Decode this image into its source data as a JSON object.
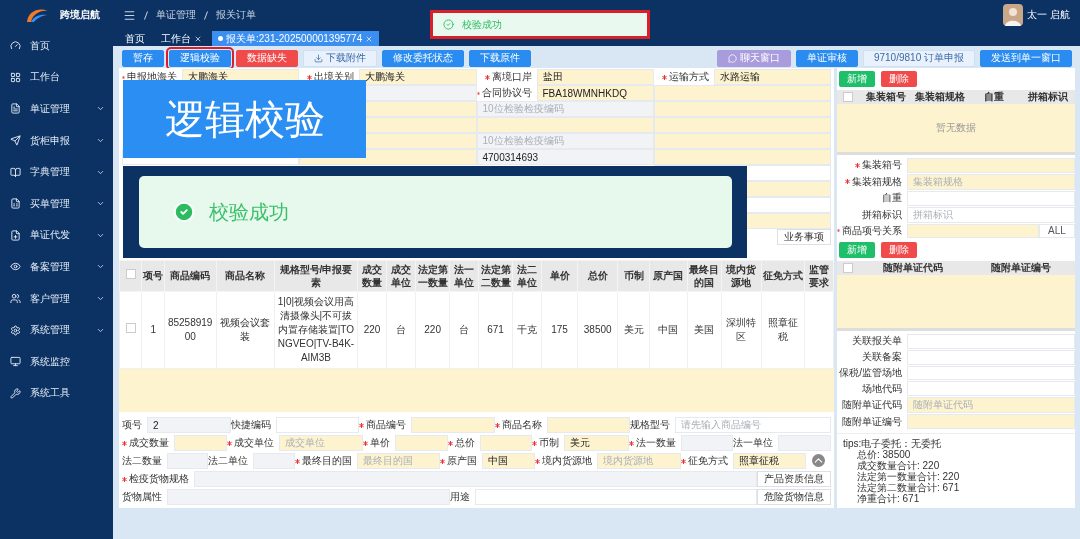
{
  "sidebar": {
    "brand": "跨境启航",
    "items": [
      {
        "label": "首页",
        "expandable": false
      },
      {
        "label": "工作台",
        "expandable": false
      },
      {
        "label": "单证管理",
        "expandable": true
      },
      {
        "label": "货柜申报",
        "expandable": true
      },
      {
        "label": "字典管理",
        "expandable": true
      },
      {
        "label": "买单管理",
        "expandable": true
      },
      {
        "label": "单证代发",
        "expandable": true
      },
      {
        "label": "备案管理",
        "expandable": true
      },
      {
        "label": "客户管理",
        "expandable": true
      },
      {
        "label": "系统管理",
        "expandable": true
      },
      {
        "label": "系统监控",
        "expandable": false
      },
      {
        "label": "系统工具",
        "expandable": false
      }
    ]
  },
  "header": {
    "breadcrumb": [
      "单证管理",
      "报关订单"
    ],
    "user": "太一 启航"
  },
  "toast": {
    "text": "校验成功"
  },
  "tabs": [
    {
      "label": "首页",
      "selected": false,
      "closable": false
    },
    {
      "label": "工作台",
      "selected": false,
      "closable": true
    },
    {
      "label": "报关单:231-202500001395774",
      "selected": true,
      "closable": true
    }
  ],
  "toolbar": {
    "left": [
      {
        "label": "暂存",
        "kind": "primary",
        "highlighted": false
      },
      {
        "label": "逻辑校验",
        "kind": "primary",
        "highlighted": true
      },
      {
        "label": "数据缺失",
        "kind": "danger",
        "highlighted": false
      },
      {
        "label": "下载附件",
        "kind": "plain",
        "highlighted": false
      },
      {
        "label": "修改委托状态",
        "kind": "primary",
        "highlighted": false
      },
      {
        "label": "下载原件",
        "kind": "primary",
        "highlighted": false
      }
    ],
    "right": [
      {
        "label": "聊天窗口",
        "kind": "chat",
        "highlighted": false
      },
      {
        "label": "单证审核",
        "kind": "primary",
        "highlighted": false
      },
      {
        "label": "9710/9810 订单申报",
        "kind": "plain",
        "highlighted": false
      },
      {
        "label": "发送到单一窗口",
        "kind": "primary",
        "highlighted": false
      }
    ]
  },
  "form": {
    "rows": [
      [
        {
          "label": "申报地海关",
          "required": true,
          "value": "大鹏海关",
          "kind": "required"
        },
        {
          "label": "出境关别",
          "required": true,
          "value": "大鹏海关",
          "kind": "required"
        },
        {
          "label": "离境口岸",
          "required": true,
          "value": "盐田",
          "kind": "required"
        },
        {
          "label": "运输方式",
          "required": true,
          "value": "水路运输",
          "kind": "required"
        }
      ],
      [
        null,
        {
          "kind": "readonly"
        },
        {
          "label": "合同协议号",
          "required": true,
          "value": "FBA18WMNHKDQ",
          "kind": "required"
        },
        {
          "kind": "required"
        }
      ],
      [
        null,
        {
          "kind": "required"
        },
        {
          "kind": "readonly",
          "placeholder": "10位检验检疫编码"
        },
        {
          "kind": "required"
        }
      ],
      [
        null,
        {
          "kind": "required"
        },
        {
          "kind": "required"
        },
        {
          "kind": "required"
        }
      ],
      [
        null,
        {
          "kind": "required"
        },
        {
          "kind": "readonly",
          "placeholder": "10位检验检疫编码"
        },
        {
          "kind": "required"
        }
      ],
      [
        {
          "kind": "plain"
        },
        {
          "kind": "required"
        },
        {
          "kind": "readonly",
          "value": "4700314693"
        },
        {
          "kind": "required"
        }
      ],
      [
        null,
        null,
        null,
        {
          "kind": "plain"
        }
      ],
      [
        null,
        null,
        null,
        {
          "kind": "required"
        }
      ],
      [
        null,
        null,
        null,
        {
          "kind": "plain"
        }
      ],
      [
        null,
        null,
        null,
        {
          "kind": "required"
        }
      ],
      [
        null,
        null,
        null,
        {
          "kind": "action",
          "value": "业务事项"
        }
      ]
    ]
  },
  "callouts": {
    "title": "逻辑校验",
    "message": "校验成功"
  },
  "goods_table": {
    "all_checked": false,
    "columns": [
      "项号",
      "商品编码",
      "商品名称",
      "规格型号/申报要素",
      "成交数量",
      "成交单位",
      "法定第一数量",
      "法一单位",
      "法定第二数量",
      "法二单位",
      "单价",
      "总价",
      "币制",
      "原产国",
      "最终目的国",
      "境内货源地",
      "征免方式",
      "监管要求"
    ],
    "rows": [
      {
        "checked": false,
        "cells": [
          "1",
          "8525891900",
          "视频会议套装",
          "1|0|视频会议用高清摄像头|不可拔内置存储装置|TONGVEO|TV-B4K-AIM3B",
          "220",
          "台",
          "220",
          "台",
          "671",
          "千克",
          "175",
          "38500",
          "美元",
          "中国",
          "美国",
          "深圳特区",
          "照章征税"
        ]
      }
    ]
  },
  "item_form": {
    "lines": [
      {
        "fields": [
          {
            "label": "项号",
            "value": "2",
            "kind": "readonly"
          },
          {
            "label": "快捷编码",
            "kind": "plain"
          },
          {
            "label": "商品编号",
            "required": true,
            "kind": "required"
          },
          {
            "label": "商品名称",
            "required": true,
            "kind": "required"
          },
          {
            "label": "规格型号",
            "placeholder": "请先输入商品编号",
            "kind": "plain"
          }
        ]
      },
      {
        "fields": [
          {
            "label": "成交数量",
            "required": true,
            "kind": "required"
          },
          {
            "label": "成交单位",
            "required": true,
            "placeholder": "成交单位",
            "kind": "required"
          },
          {
            "label": "单价",
            "required": true,
            "kind": "required"
          },
          {
            "label": "总价",
            "required": true,
            "kind": "required"
          },
          {
            "label": "币制",
            "required": true,
            "value": "美元",
            "kind": "required"
          },
          {
            "label": "法一数量",
            "required": true,
            "kind": "readonly"
          },
          {
            "label": "法一单位",
            "kind": "readonly"
          }
        ]
      },
      {
        "fields": [
          {
            "label": "法二数量",
            "kind": "readonly"
          },
          {
            "label": "法二单位",
            "kind": "readonly"
          },
          {
            "label": "最终目的国",
            "required": true,
            "placeholder": "最终目的国",
            "kind": "required"
          },
          {
            "label": "原产国",
            "required": true,
            "value": "中国",
            "kind": "required"
          },
          {
            "label": "境内货源地",
            "required": true,
            "placeholder": "境内货源地",
            "kind": "required"
          },
          {
            "label": "征免方式",
            "required": true,
            "value": "照章征税",
            "kind": "required"
          }
        ]
      },
      {
        "fields": [
          {
            "label": "检疫货物规格",
            "required": true,
            "kind": "readonly"
          },
          {
            "label": "产品资质信息",
            "kind": "action"
          }
        ]
      },
      {
        "fields": [
          {
            "label": "货物属性",
            "kind": "readonly"
          },
          {
            "label": "用途",
            "kind": "plain"
          },
          {
            "label": "危险货物信息",
            "kind": "action"
          }
        ]
      }
    ]
  },
  "containers": {
    "add": "新增",
    "delete": "删除",
    "all_checked": false,
    "columns": [
      "集装箱号",
      "集装箱规格",
      "自重",
      "拼箱标识"
    ],
    "empty": "暂无数据",
    "fields": [
      {
        "label": "集装箱号",
        "required": true,
        "kind": "required"
      },
      {
        "label": "集装箱规格",
        "required": true,
        "placeholder": "集装箱规格",
        "kind": "required"
      },
      {
        "label": "自重",
        "kind": "plain"
      },
      {
        "label": "拼箱标识",
        "placeholder": "拼箱标识",
        "kind": "plain"
      },
      {
        "label": "商品项号关系",
        "required": true,
        "kind": "required",
        "addon": "ALL"
      }
    ]
  },
  "documents": {
    "add": "新增",
    "delete": "删除",
    "all_checked": false,
    "columns": [
      "随附单证代码",
      "随附单证编号"
    ],
    "fields": [
      {
        "label": "关联报关单",
        "kind": "plain"
      },
      {
        "label": "关联备案",
        "kind": "plain"
      },
      {
        "label": "保税/监管场地",
        "kind": "plain"
      },
      {
        "label": "场地代码",
        "kind": "plain"
      },
      {
        "label": "随附单证代码",
        "placeholder": "随附单证代码",
        "kind": "required"
      },
      {
        "label": "随附单证编号",
        "kind": "required"
      }
    ]
  },
  "tips": [
    "tips:电子委托：无委托",
    "总价: 38500",
    "成交数量合计: 220",
    "法定第一数量合计: 220",
    "法定第二数量合计: 671",
    "净重合计: 671"
  ]
}
